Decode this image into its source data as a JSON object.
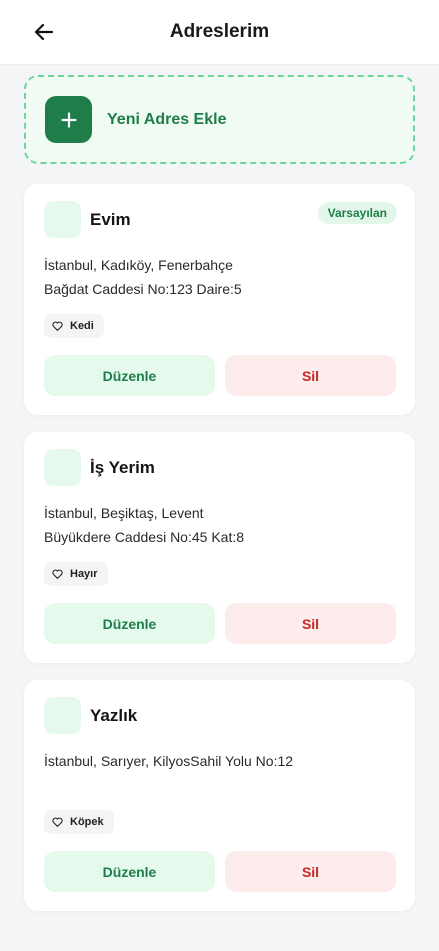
{
  "header": {
    "title": "Adreslerim"
  },
  "add_address": {
    "label": "Yeni Adres Ekle"
  },
  "addresses": [
    {
      "title": "Evim",
      "badge": "Varsayılan",
      "line1": "İstanbul, Kadıköy, Fenerbahçe",
      "line2": "Bağdat Caddesi No:123 Daire:5",
      "pet": "Kedi",
      "edit_label": "Düzenle",
      "delete_label": "Sil"
    },
    {
      "title": "İş Yerim",
      "line1": "İstanbul, Beşiktaş, Levent",
      "line2": "Büyükdere Caddesi No:45 Kat:8",
      "pet": "Hayır",
      "edit_label": "Düzenle",
      "delete_label": "Sil"
    },
    {
      "title": "Yazlık",
      "line1": "İstanbul, Sarıyer, KilyosSahil Yolu No:12",
      "pet": "Köpek",
      "edit_label": "Düzenle",
      "delete_label": "Sil"
    }
  ],
  "icons": {
    "back": "arrow-left-icon",
    "add": "plus-icon",
    "pet": "heart-icon"
  },
  "colors": {
    "brand_green": "#1e7d49",
    "delete_red": "#c62828"
  }
}
